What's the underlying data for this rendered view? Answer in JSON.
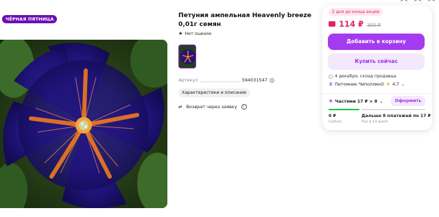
{
  "badge": "ЧЁРНАЯ ПЯТНИЦА",
  "product": {
    "title": "Петуния ампельная Heavenly breeze 0,01г семян",
    "rating_text": "Нет оценок",
    "article_label": "Артикул",
    "article_value": "594031547",
    "specs_chip": "Характеристики и описание",
    "return_text": "Возврат через заявку"
  },
  "buy_card": {
    "deal_badge": "2 дня до конца акции",
    "price_now": "114 ₽",
    "price_old": "300 ₽",
    "add_to_cart": "Добавить в корзину",
    "buy_now": "Купить сейчас",
    "delivery": "4 декабря, склад продавца",
    "seller_name": "Питомник ЧиполлинО",
    "seller_rating": "4,7",
    "installment_text": "Частями 17 ₽ × 8",
    "apply_button": "Оформить",
    "pay_now_amount": "0 ₽",
    "pay_now_label": "Сейчас",
    "pay_later_amount": "Дальше 8 платежей по 17 ₽",
    "pay_later_label": "Раз в 14 дней"
  },
  "colors": {
    "accent": "#a43bf0",
    "price": "#e0245e",
    "badge_bg": "#6b0fb3"
  }
}
